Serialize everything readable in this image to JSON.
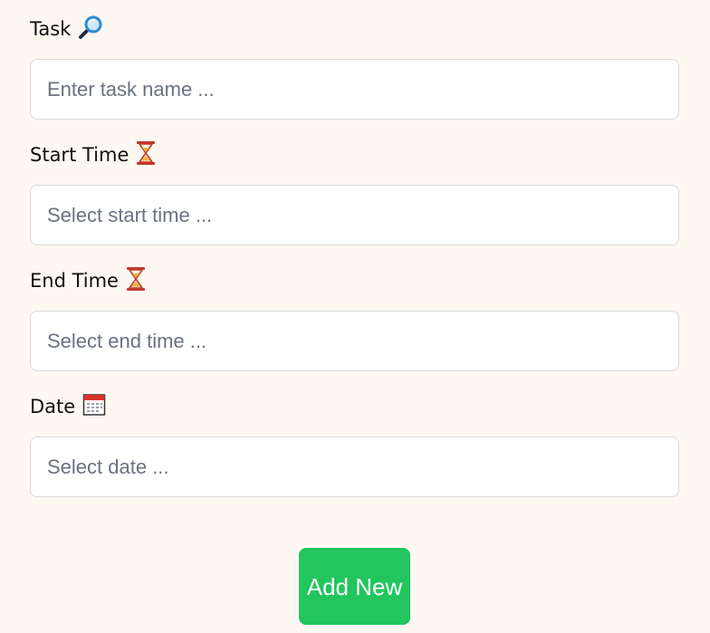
{
  "form": {
    "fields": [
      {
        "label": "Task",
        "icon": "magnifier-icon",
        "placeholder": "Enter task name ..."
      },
      {
        "label": "Start Time",
        "icon": "hourglass-icon",
        "placeholder": "Select start time ..."
      },
      {
        "label": "End Time",
        "icon": "hourglass-icon",
        "placeholder": "Select end time ..."
      },
      {
        "label": "Date",
        "icon": "calendar-icon",
        "placeholder": "Select date ..."
      }
    ],
    "submit_label": "Add New"
  },
  "colors": {
    "background": "#fdf8f2",
    "button": "#22c55e",
    "button_text": "#ffffff",
    "input_border": "#d9d9dc"
  }
}
